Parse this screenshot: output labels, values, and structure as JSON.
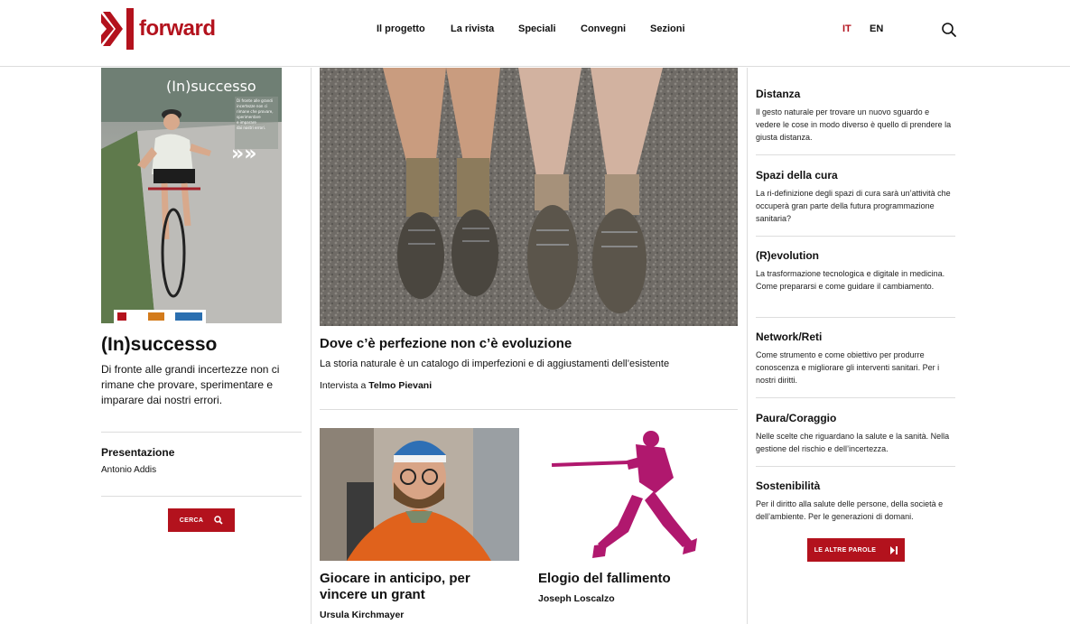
{
  "brand": {
    "name": "forward",
    "accent": "#b3121d"
  },
  "nav": {
    "items": [
      "Il progetto",
      "La rivista",
      "Speciali",
      "Convegni",
      "Sezioni"
    ],
    "lang_it": "IT",
    "lang_en": "EN",
    "search_icon": "search-icon"
  },
  "sidebar_left": {
    "cover": {
      "title": "(In)successo",
      "blurb": "Di fronte alle grandi incertezze non ci rimane che provare, sperimentare e imparare dai nostri errori."
    },
    "title": "(In)successo",
    "description": "Di fronte alle grandi incertezze non ci rimane che provare, sperimentare e imparare dai nostri errori.",
    "presentation_label": "Presentazione",
    "presentation_author": "Antonio Addis",
    "search_button": "CERCA"
  },
  "main": {
    "featured": {
      "title": "Dove c’è perfezione non c’è evoluzione",
      "subtitle": "La storia naturale è un catalogo di imperfezioni e di aggiustamenti dell’esistente",
      "author_prefix": "Intervista a",
      "author": "Telmo Pievani"
    },
    "cards": [
      {
        "title": "Giocare in anticipo, per vincere un grant",
        "author": "Ursula Kirchmayer"
      },
      {
        "title": "Elogio del fallimento",
        "author": "Joseph Loscalzo"
      }
    ]
  },
  "sidebar_right": {
    "words": [
      {
        "title": "Distanza",
        "text": "Il gesto naturale per trovare un nuovo sguardo e vedere le cose in modo diverso è quello di prendere la giusta distanza."
      },
      {
        "title": "Spazi della cura",
        "text": "La ri-definizione degli spazi di cura sarà un’attività che occuperà gran parte della futura programmazione sanitaria?"
      },
      {
        "title": "(R)evolution",
        "text": "La trasformazione tecnologica e digitale in medicina. Come prepararsi e come guidare il cambiamento."
      },
      {
        "title": "Network/Reti",
        "text": "Come strumento e come obiettivo per produrre conoscenza e migliorare gli interventi sanitari. Per i nostri diritti."
      },
      {
        "title": "Paura/Coraggio",
        "text": "Nelle scelte che riguardano la salute e la sanità. Nella gestione del rischio e dell’incertezza."
      },
      {
        "title": "Sostenibilità",
        "text": "Per il diritto alla salute delle persone, della società e dell’ambiente. Per le generazioni di domani."
      }
    ],
    "more_button": "LE ALTRE PAROLE"
  }
}
